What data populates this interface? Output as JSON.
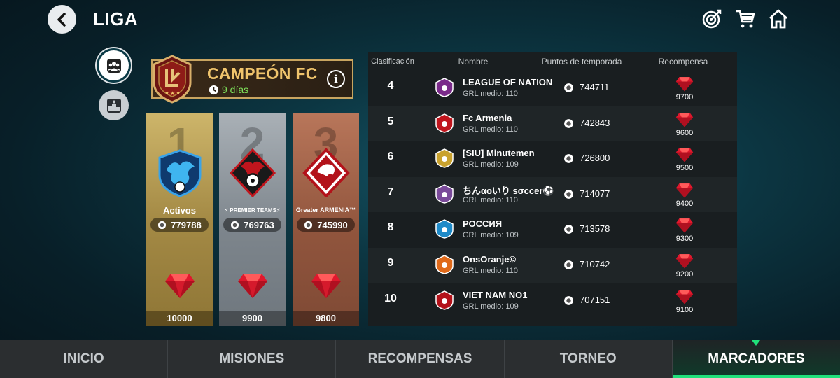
{
  "header": {
    "title": "LIGA",
    "icons": [
      "back-icon",
      "target-icon",
      "cart-icon",
      "home-icon"
    ]
  },
  "sidebar": {
    "icons": [
      "teams-icon",
      "podium-icon"
    ]
  },
  "division": {
    "name": "CAMPEÓN FC",
    "time_left": "9 días",
    "info_label": "i"
  },
  "podium": [
    {
      "rank": "1",
      "team": "Activos",
      "points": "779788",
      "reward": "10000"
    },
    {
      "rank": "2",
      "team": "⚡ PREMIER TEAMS⚡",
      "points": "769763",
      "reward": "9900"
    },
    {
      "rank": "3",
      "team": "Greater ARMENIA™",
      "points": "745990",
      "reward": "9800"
    }
  ],
  "table": {
    "headers": {
      "rank": "Clasificación",
      "name": "Nombre",
      "points": "Puntos de temporada",
      "reward": "Recompensa"
    },
    "rows": [
      {
        "rank": "4",
        "name": "LEAGUE OF NATION",
        "grl": "GRL medio: 110",
        "points": "744711",
        "reward": "9700"
      },
      {
        "rank": "5",
        "name": "Fc Armenia",
        "grl": "GRL medio: 110",
        "points": "742843",
        "reward": "9600"
      },
      {
        "rank": "6",
        "name": "[SIU] Minutemen",
        "grl": "GRL medio: 109",
        "points": "726800",
        "reward": "9500"
      },
      {
        "rank": "7",
        "name": "ちんαoいり ѕσccer⚽",
        "grl": "GRL medio: 110",
        "points": "714077",
        "reward": "9400"
      },
      {
        "rank": "8",
        "name": "РОССИЯ",
        "grl": "GRL medio: 109",
        "points": "713578",
        "reward": "9300"
      },
      {
        "rank": "9",
        "name": "OnsOranje©",
        "grl": "GRL medio: 110",
        "points": "710742",
        "reward": "9200"
      },
      {
        "rank": "10",
        "name": "VIET NAM NO1",
        "grl": "GRL medio: 109",
        "points": "707151",
        "reward": "9100"
      }
    ]
  },
  "tabs": [
    {
      "label": "INICIO",
      "active": false
    },
    {
      "label": "MISIONES",
      "active": false
    },
    {
      "label": "RECOMPENSAS",
      "active": false
    },
    {
      "label": "TORNEO",
      "active": false
    },
    {
      "label": "MARCADORES",
      "active": true
    }
  ],
  "colors": {
    "accent_green": "#20e07a",
    "gold": "#f0c46c",
    "timer_green": "#7ee05a",
    "gem_red": "#e0182d"
  }
}
